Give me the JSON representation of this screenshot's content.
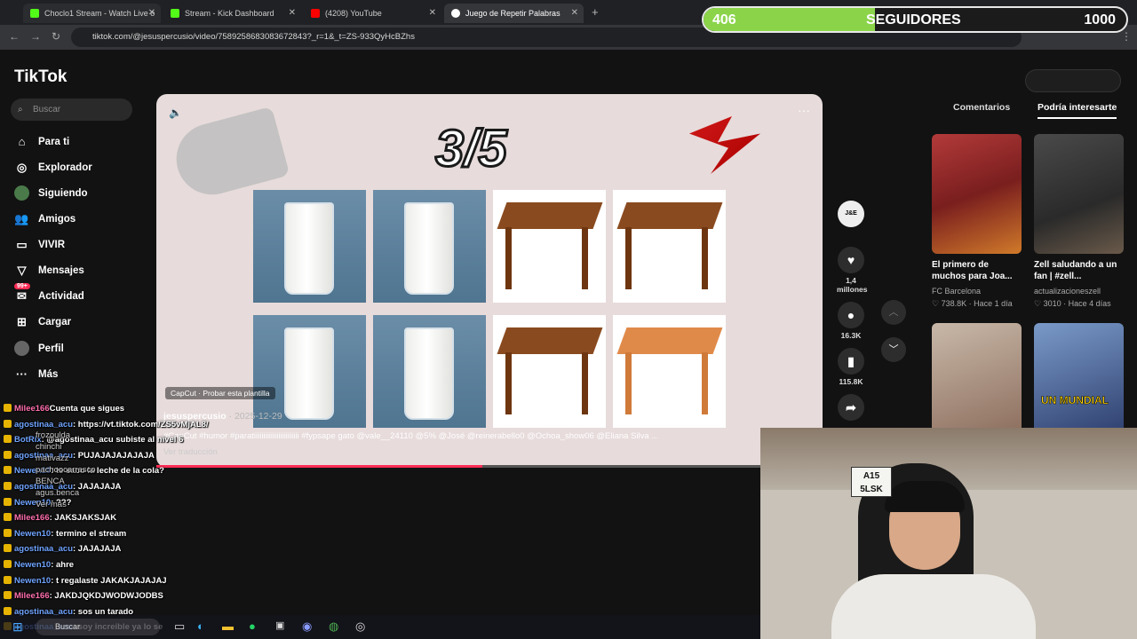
{
  "browser": {
    "tabs": [
      {
        "label": "Choclo1 Stream - Watch Live o",
        "color": "#53fc18"
      },
      {
        "label": "Stream - Kick Dashboard",
        "color": "#53fc18"
      },
      {
        "label": "(4208) YouTube",
        "color": "#ff0000"
      },
      {
        "label": "Juego de Repetir Palabras",
        "color": "#ffffff"
      }
    ],
    "url": "tiktok.com/@jesuspercusio/video/7589258683083672843?_r=1&_t=ZS-933QyHcBZhs"
  },
  "followers": {
    "current": "406",
    "label": "SEGUIDORES",
    "goal": "1000",
    "progress": 0.406
  },
  "tiktok": {
    "logo": "TikTok",
    "search_placeholder": "Buscar",
    "nav": [
      "Para ti",
      "Explorador",
      "Siguiendo",
      "Amigos",
      "VIVIR",
      "Mensajes",
      "Actividad",
      "Cargar",
      "Perfil",
      "Más"
    ],
    "activity_badge": "99+",
    "video": {
      "counter": "3/5",
      "capcut": "CapCut · Probar esta plantilla",
      "author": "jesuspercusio",
      "date": "2025-12-29",
      "caption": "#CapCut #humor #paratiiiiiiiiiiiiiiiiiiiiiiii #fypsape gato @vale__24110 @5% @José @reinerabello0 @Ochoa_show06 @Eliana Silva ...",
      "translate": "Ver traducción",
      "progress": 0.54
    },
    "actions": {
      "avatar": "J&E",
      "likes": "1,4 millones",
      "comments": "16.3K",
      "saves": "115.8K"
    },
    "right_tabs": [
      "Comentarios",
      "Podría interesarte"
    ],
    "cards": [
      {
        "title": "El primero de muchos para Joa...",
        "author": "FC Barcelona",
        "likes": "738.8K",
        "age": "Hace 1 día"
      },
      {
        "title": "Zell saludando a un fan | #zell...",
        "author": "actualizacioneszell",
        "likes": "3010",
        "age": "Hace 4 días"
      },
      {
        "title": "",
        "author": "",
        "likes": "",
        "age": ""
      },
      {
        "title": "UN MUNDIAL",
        "author": "",
        "likes": "",
        "age": ""
      }
    ]
  },
  "chat": [
    {
      "user": "Milee166",
      "msg": "Cuenta que sigues",
      "pink": true
    },
    {
      "user": "agostinaa_acu",
      "msg": ": https://vt.tiktok.com/ZS5vMjAL8/",
      "pink": false
    },
    {
      "user": "BotRix",
      "msg": ": @agostinaa_acu subiste al nivel 6",
      "pink": false
    },
    {
      "user": "agostinaa_acu",
      "msg": ": PUJAJAJAJAJAJA",
      "pink": false
    },
    {
      "user": "Newen10",
      "msg": ": te saco la leche de la cola?",
      "pink": false
    },
    {
      "user": "agostinaa_acu",
      "msg": ": JAJAJAJA",
      "pink": false
    },
    {
      "user": "Newen10",
      "msg": ": ???",
      "pink": false
    },
    {
      "user": "Milee166",
      "msg": ": JAKSJAKSJAK",
      "pink": true
    },
    {
      "user": "Newen10",
      "msg": ": termino el stream",
      "pink": false
    },
    {
      "user": "agostinaa_acu",
      "msg": ": JAJAJAJA",
      "pink": false
    },
    {
      "user": "Newen10",
      "msg": ": ahre",
      "pink": false
    },
    {
      "user": "Newen10",
      "msg": ": t regalaste JAKAKJAJAJAJ",
      "pink": false
    },
    {
      "user": "Milee166",
      "msg": ": JAKDJQKDJWODWJODBS",
      "pink": true
    },
    {
      "user": "agostinaa_acu",
      "msg": ": sos un tarado",
      "pink": false
    },
    {
      "user": "agostinaa_acu",
      "msg": ": soy increible ya lo se",
      "pink": false
    }
  ],
  "following_list": [
    "frozoulda",
    "chinchi",
    "mativazz",
    "pachoocarrasco",
    "BENCA",
    "agus.benca",
    "Ver más"
  ],
  "taskbar": {
    "search": "Buscar"
  },
  "webcam": {
    "plate": "A15 5LSK"
  }
}
